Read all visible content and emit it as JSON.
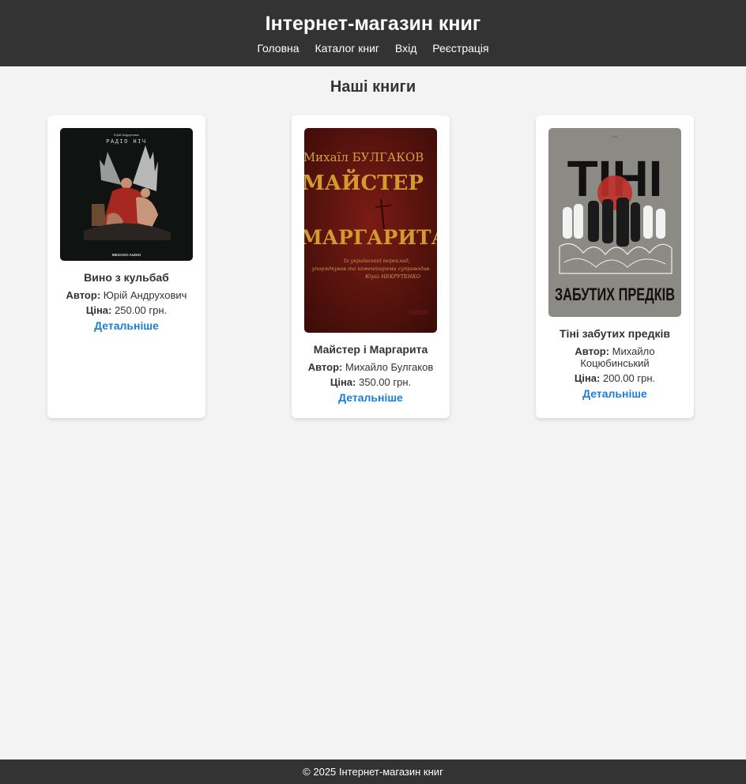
{
  "header": {
    "title": "Інтернет-магазин книг",
    "nav": [
      "Головна",
      "Каталог книг",
      "Вхід",
      "Реєстрація"
    ]
  },
  "main": {
    "heading": "Наші книги",
    "books": [
      {
        "title": "Вино з кульбаб",
        "author_label": "Автор:",
        "author": "Юрій Андрухович",
        "price_label": "Ціна:",
        "price": "250.00 грн.",
        "link": "Детальніше",
        "cover": {
          "top_small": "Юрій Андрухович",
          "title": "РАДІО НІЧ",
          "publisher": "MEGOGO AUDIO",
          "background": "#0f1412"
        }
      },
      {
        "title": "Майстер і Маргарита",
        "author_label": "Автор:",
        "author": "Михайло Булгаков",
        "price_label": "Ціна:",
        "price": "350.00 грн.",
        "link": "Детальніше",
        "cover": {
          "author": "Михаїл БУЛГАКОВ",
          "title_1": "МАЙСТЕР",
          "title_2": "МАРГАРИТА",
          "subtitle": "Із української переклад, упорядкував та коментарями супроводив Юрій НЕКРУТЕНКО",
          "background": "#5a1410"
        }
      },
      {
        "title": "Тіні забутих предків",
        "author_label": "Автор:",
        "author": "Михайло Коцюбинський",
        "price_label": "Ціна:",
        "price": "200.00 грн.",
        "link": "Детальніше",
        "cover": {
          "title_1": "ТІНІ",
          "title_2": "ЗАБУТИХ ПРЕДКІВ",
          "background": "#8b8a85"
        }
      }
    ]
  },
  "footer": {
    "text": "© 2025 Інтернет-магазин книг"
  }
}
